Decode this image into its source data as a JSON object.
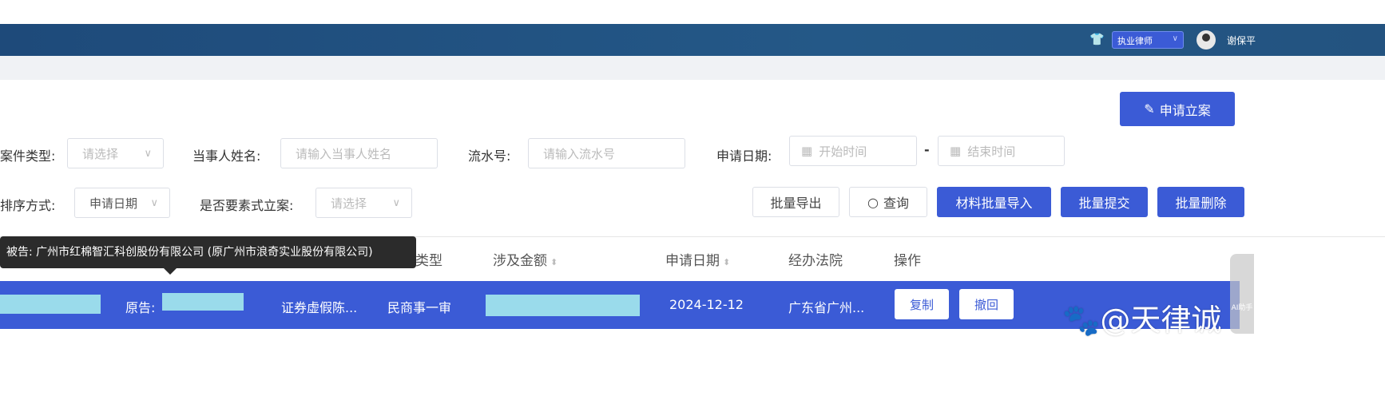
{
  "header": {
    "role_select": "执业律师",
    "user_name": "谢保平"
  },
  "actions": {
    "apply_case": "申请立案"
  },
  "filters": {
    "case_type_label": "案件类型:",
    "case_type_placeholder": "请选择",
    "party_name_label": "当事人姓名:",
    "party_name_placeholder": "请输入当事人姓名",
    "serial_label": "流水号:",
    "serial_placeholder": "请输入流水号",
    "apply_date_label": "申请日期:",
    "start_placeholder": "开始时间",
    "end_placeholder": "结束时间",
    "date_sep": "-",
    "sort_label": "排序方式:",
    "sort_value": "申请日期",
    "element_label": "是否要素式立案:",
    "element_placeholder": "请选择"
  },
  "toolbar": {
    "export": "批量导出",
    "query": "查询",
    "import": "材料批量导入",
    "submit": "批量提交",
    "delete": "批量删除"
  },
  "table": {
    "headers": {
      "type": "类型",
      "amount": "涉及金额",
      "date": "申请日期",
      "court": "经办法院",
      "ops": "操作"
    },
    "row": {
      "plaintiff_label": "原告:",
      "cause": "证券虚假陈...",
      "type": "民商事一审",
      "date": "2024-12-12",
      "court": "广东省广州...",
      "copy": "复制",
      "withdraw": "撤回"
    }
  },
  "tooltip": "被告: 广州市红棉智汇科创股份有限公司 (原广州市浪奇实业股份有限公司)",
  "watermark": "@天律诚",
  "side_widget": "AI助手"
}
